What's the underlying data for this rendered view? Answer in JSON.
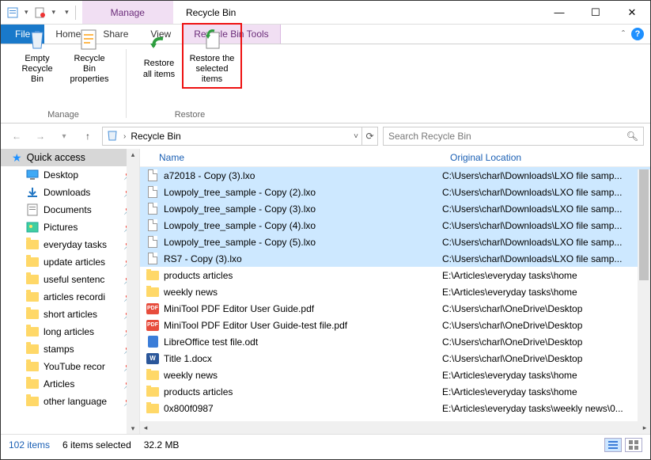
{
  "qat": {
    "prop_glyph": "",
    "new_glyph": "",
    "del_glyph": ""
  },
  "titlebar": {
    "tool_tab": "Manage",
    "app_title": "Recycle Bin"
  },
  "tabs": {
    "file": "File",
    "home": "Home",
    "share": "Share",
    "view": "View",
    "rb_tools": "Recycle Bin Tools"
  },
  "ribbon": {
    "empty": "Empty Recycle Bin",
    "props": "Recycle Bin properties",
    "restore_all": "Restore all items",
    "restore_sel": "Restore the selected items",
    "grp_manage": "Manage",
    "grp_restore": "Restore"
  },
  "address": {
    "path": "Recycle Bin",
    "search_placeholder": "Search Recycle Bin"
  },
  "sidebar": {
    "quick_access": "Quick access",
    "items": [
      {
        "label": "Desktop",
        "icon": "desktop",
        "pinned": true
      },
      {
        "label": "Downloads",
        "icon": "downloads",
        "pinned": true
      },
      {
        "label": "Documents",
        "icon": "documents",
        "pinned": true
      },
      {
        "label": "Pictures",
        "icon": "pictures",
        "pinned": true
      },
      {
        "label": "everyday tasks",
        "icon": "folder",
        "pinned": true
      },
      {
        "label": "update articles",
        "icon": "folder",
        "pinned": true
      },
      {
        "label": "useful sentenc",
        "icon": "folder",
        "pinned": true
      },
      {
        "label": "articles recordi",
        "icon": "folder",
        "pinned": true
      },
      {
        "label": "short articles",
        "icon": "folder",
        "pinned": true
      },
      {
        "label": "long articles",
        "icon": "folder",
        "pinned": true
      },
      {
        "label": "stamps",
        "icon": "folder",
        "pinned": true
      },
      {
        "label": "YouTube recor",
        "icon": "folder",
        "pinned": true
      },
      {
        "label": "Articles",
        "icon": "folder",
        "pinned": true
      },
      {
        "label": "other language",
        "icon": "folder",
        "pinned": true
      }
    ]
  },
  "columns": {
    "name": "Name",
    "location": "Original Location"
  },
  "rows": [
    {
      "sel": true,
      "type": "lxo",
      "name": "a72018 - Copy (3).lxo",
      "loc": "C:\\Users\\charl\\Downloads\\LXO file samp..."
    },
    {
      "sel": true,
      "type": "lxo",
      "name": "Lowpoly_tree_sample - Copy (2).lxo",
      "loc": "C:\\Users\\charl\\Downloads\\LXO file samp..."
    },
    {
      "sel": true,
      "type": "lxo",
      "name": "Lowpoly_tree_sample - Copy (3).lxo",
      "loc": "C:\\Users\\charl\\Downloads\\LXO file samp..."
    },
    {
      "sel": true,
      "type": "lxo",
      "name": "Lowpoly_tree_sample - Copy (4).lxo",
      "loc": "C:\\Users\\charl\\Downloads\\LXO file samp..."
    },
    {
      "sel": true,
      "type": "lxo",
      "name": "Lowpoly_tree_sample - Copy (5).lxo",
      "loc": "C:\\Users\\charl\\Downloads\\LXO file samp..."
    },
    {
      "sel": true,
      "type": "lxo",
      "name": "RS7 - Copy (3).lxo",
      "loc": "C:\\Users\\charl\\Downloads\\LXO file samp..."
    },
    {
      "sel": false,
      "type": "folder",
      "name": "products articles",
      "loc": "E:\\Articles\\everyday tasks\\home"
    },
    {
      "sel": false,
      "type": "folder",
      "name": "weekly news",
      "loc": "E:\\Articles\\everyday tasks\\home"
    },
    {
      "sel": false,
      "type": "pdf",
      "name": "MiniTool PDF Editor User Guide.pdf",
      "loc": "C:\\Users\\charl\\OneDrive\\Desktop"
    },
    {
      "sel": false,
      "type": "pdf",
      "name": "MiniTool PDF Editor User Guide-test file.pdf",
      "loc": "C:\\Users\\charl\\OneDrive\\Desktop"
    },
    {
      "sel": false,
      "type": "odt",
      "name": "LibreOffice test file.odt",
      "loc": "C:\\Users\\charl\\OneDrive\\Desktop"
    },
    {
      "sel": false,
      "type": "docx",
      "name": "Title 1.docx",
      "loc": "C:\\Users\\charl\\OneDrive\\Desktop"
    },
    {
      "sel": false,
      "type": "folder",
      "name": "weekly news",
      "loc": "E:\\Articles\\everyday tasks\\home"
    },
    {
      "sel": false,
      "type": "folder",
      "name": "products articles",
      "loc": "E:\\Articles\\everyday tasks\\home"
    },
    {
      "sel": false,
      "type": "folder",
      "name": "0x800f0987",
      "loc": "E:\\Articles\\everyday tasks\\weekly news\\0..."
    }
  ],
  "status": {
    "count": "102 items",
    "selected": "6 items selected",
    "size": "32.2 MB"
  }
}
